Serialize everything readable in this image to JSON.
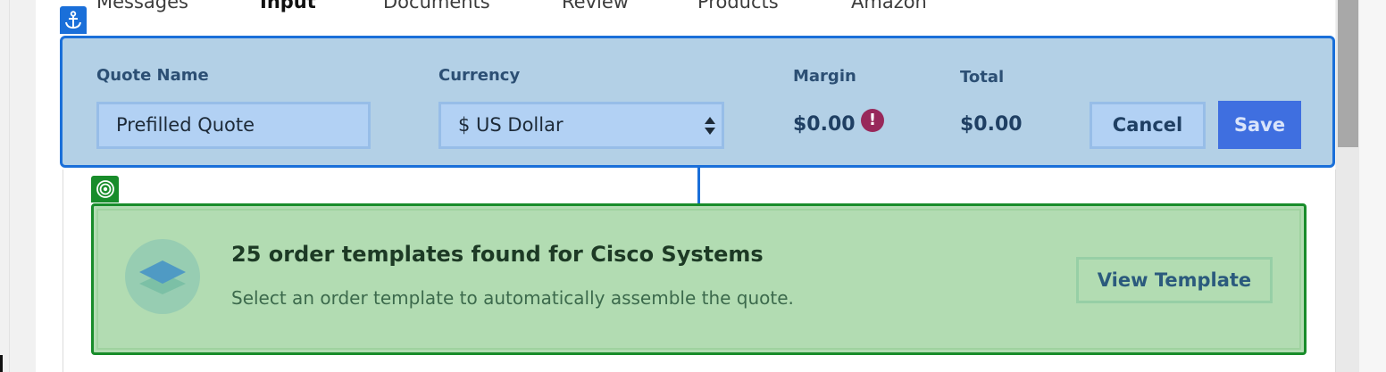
{
  "tabs": [
    {
      "label": "Messages",
      "active": false
    },
    {
      "label": "Input",
      "active": true
    },
    {
      "label": "Documents",
      "active": false
    },
    {
      "label": "Review",
      "active": false
    },
    {
      "label": "Products",
      "active": false
    },
    {
      "label": "Amazon",
      "active": false
    }
  ],
  "quote": {
    "name_label": "Quote Name",
    "name_value": "Prefilled Quote",
    "currency_label": "Currency",
    "currency_value": "$ US Dollar",
    "margin_label": "Margin",
    "margin_value": "$0.00",
    "alert_glyph": "!",
    "total_label": "Total",
    "total_value": "$0.00",
    "cancel_label": "Cancel",
    "save_label": "Save"
  },
  "template_banner": {
    "title": "25 order templates found for Cisco Systems",
    "subtitle": "Select an order template to automatically assemble the quote.",
    "button_label": "View Template"
  },
  "icons": {
    "anchor": "anchor-icon",
    "target": "target-icon",
    "alert": "alert-icon",
    "layers": "layers-icon",
    "select_arrows": "sort-arrows-icon"
  },
  "colors": {
    "highlight_blue": "#1a6fd9",
    "highlight_green": "#188c2a",
    "save_button": "#3f6fe0",
    "alert": "#98285a"
  }
}
